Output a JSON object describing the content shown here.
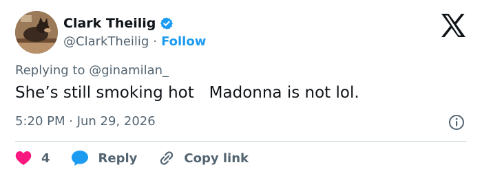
{
  "author": {
    "name": "Clark Theilig",
    "handle": "@ClarkTheilig",
    "separator": "·",
    "follow_label": "Follow",
    "verified_icon": "verified-badge-icon"
  },
  "tweet": {
    "replying_to": "Replying to @ginamilan_",
    "text": "She’s still smoking hot   Madonna is not lol.",
    "timestamp": "5:20 PM · Jun 29, 2026"
  },
  "actions": {
    "like_count": "4",
    "reply_label": "Reply",
    "copy_link_label": "Copy link"
  },
  "colors": {
    "accent": "#1d9bf0",
    "like": "#f91880",
    "text": "#0f1419",
    "muted": "#536471",
    "divider": "#cfd9de"
  }
}
